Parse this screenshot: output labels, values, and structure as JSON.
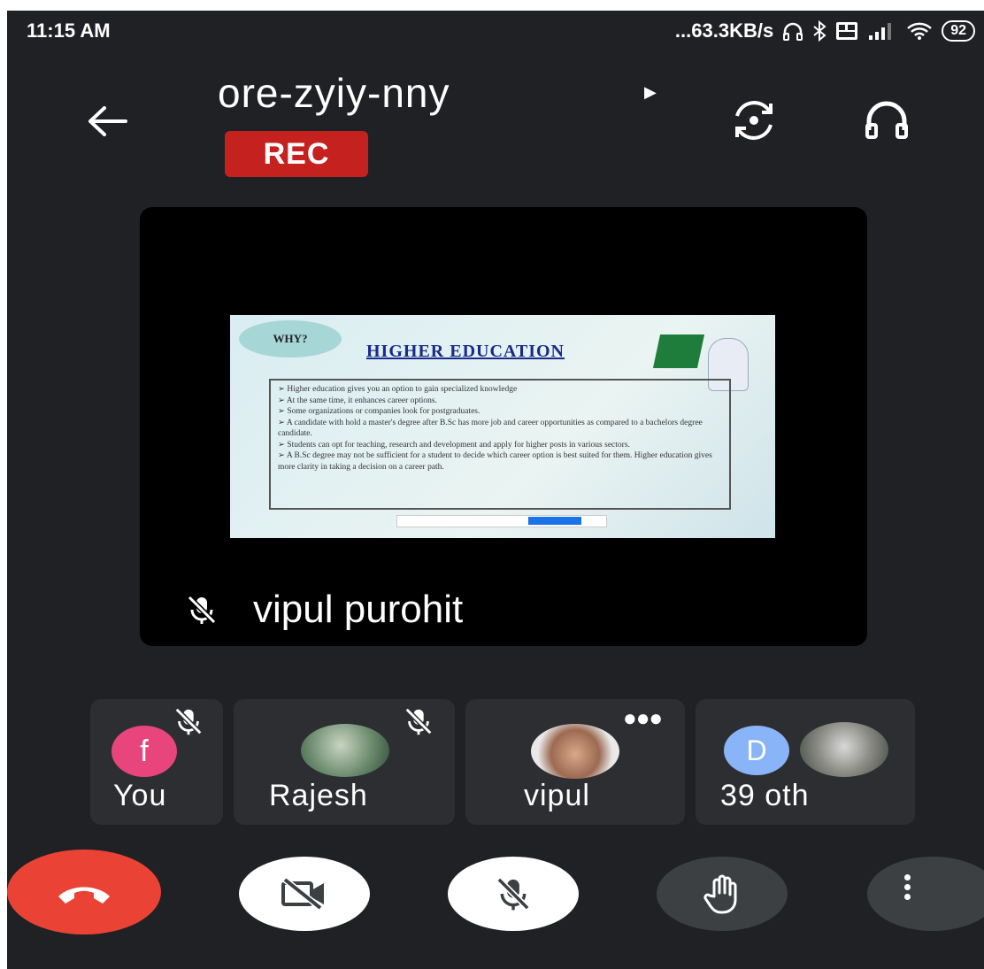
{
  "status_bar": {
    "time": "11:15 AM",
    "network_speed": "...63.3KB/s",
    "battery": "92"
  },
  "meeting": {
    "code": "ore-zyiy-nny",
    "rec_label": "REC"
  },
  "presentation": {
    "tag": "WHY?",
    "title": "HIGHER EDUCATION",
    "bullets": [
      "Higher education gives you an option to gain specialized knowledge",
      "At the same time, it enhances career options.",
      "Some organizations or companies look for postgraduates.",
      "A candidate with hold a master's degree after B.Sc has more job and career opportunities as compared to a bachelors degree candidate.",
      "Students can opt for teaching, research and development and apply for higher posts in various sectors.",
      "A B.Sc degree may not be sufficient for a student to decide which career option is best suited for them. Higher education gives more clarity in taking a decision on a career path."
    ]
  },
  "presenter": {
    "name": "vipul purohit"
  },
  "participants": [
    {
      "label": "You",
      "initial": "f",
      "avatar_color": "#e8457c"
    },
    {
      "label": "Rajesh"
    },
    {
      "label": "vipul"
    },
    {
      "label": "39 oth",
      "initial": "D",
      "avatar_color": "#8ab4f8"
    }
  ],
  "colors": {
    "background": "#202124",
    "tile": "#2d2e31",
    "rec": "#c5221f",
    "end_call": "#ea4335"
  }
}
